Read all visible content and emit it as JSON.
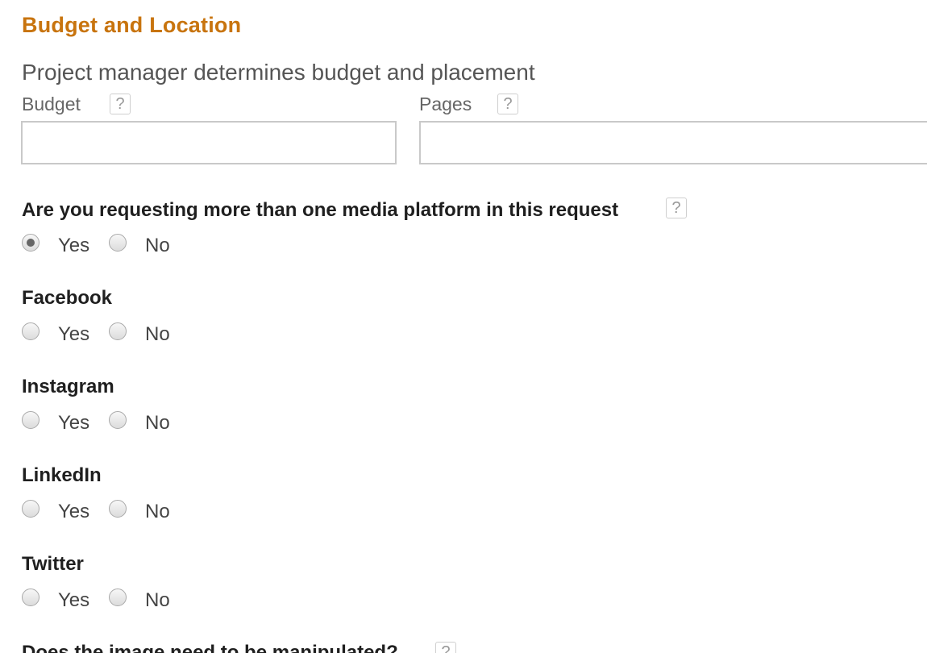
{
  "section": {
    "title": "Budget and Location",
    "subtitle": "Project manager determines budget and placement"
  },
  "fields": {
    "budget": {
      "label": "Budget",
      "help": "?",
      "value": ""
    },
    "pages": {
      "label": "Pages",
      "help": "?",
      "value": ""
    }
  },
  "multi_platform": {
    "question": "Are you requesting more than one media platform in this request",
    "help": "?",
    "yes_label": "Yes",
    "no_label": "No",
    "selected": "Yes"
  },
  "platforms": [
    {
      "name": "Facebook",
      "yes_label": "Yes",
      "no_label": "No",
      "selected": ""
    },
    {
      "name": "Instagram",
      "yes_label": "Yes",
      "no_label": "No",
      "selected": ""
    },
    {
      "name": "LinkedIn",
      "yes_label": "Yes",
      "no_label": "No",
      "selected": ""
    },
    {
      "name": "Twitter",
      "yes_label": "Yes",
      "no_label": "No",
      "selected": ""
    }
  ],
  "next_question": {
    "question": "Does the image need to be manipulated?",
    "help": "?"
  },
  "colors": {
    "accent": "#c8740e"
  }
}
